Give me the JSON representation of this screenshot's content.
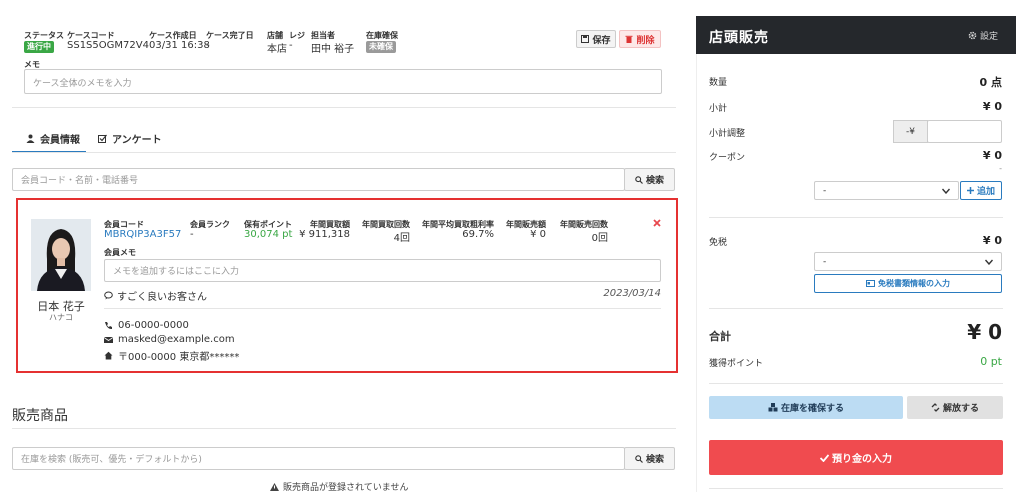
{
  "case": {
    "status_label": "ステータス",
    "status_badge": "進行中",
    "status_color": "#3aa745",
    "code_label": "ケースコード",
    "code_value": "SS1S5OGM72V4",
    "created_label": "ケース作成日",
    "created_value": "03/31 16:38",
    "completed_label": "ケース完了日",
    "completed_value": "-",
    "store_label": "店舗",
    "store_value": "本店",
    "register_label": "レジ",
    "register_value": "-",
    "staff_label": "担当者",
    "staff_value": "田中 裕子",
    "stock_label": "在庫確保",
    "stock_badge": "未確保",
    "save_label": "保存",
    "delete_label": "削除",
    "memo_label": "メモ",
    "memo_placeholder": "ケース全体のメモを入力"
  },
  "tabs": [
    {
      "label": "会員情報",
      "active": true
    },
    {
      "label": "アンケート",
      "active": false
    }
  ],
  "member_search": {
    "placeholder": "会員コード・名前・電話番号",
    "button": "検索"
  },
  "member": {
    "name": "日本 花子",
    "kana": "ハナコ",
    "code_label": "会員コード",
    "code_value": "MBRQIP3A3F57",
    "rank_label": "会員ランク",
    "rank_value": "-",
    "points_label": "保有ポイント",
    "points_value": "30,074 pt",
    "annual_buy_label": "年間買取額",
    "annual_buy_value": "¥ 911,318",
    "annual_buy_count_label": "年間買取回数",
    "annual_buy_count_value": "4回",
    "annual_margin_label": "年間平均買取粗利率",
    "annual_margin_value": "69.7%",
    "annual_sales_label": "年間販売額",
    "annual_sales_value": "¥ 0",
    "annual_sales_count_label": "年間販売回数",
    "annual_sales_count_value": "0回",
    "memo_label": "会員メモ",
    "memo_placeholder": "メモを追加するにはここに入力",
    "comment": "すごく良いお客さん",
    "comment_date": "2023/03/14",
    "phone": "06-0000-0000",
    "email": "masked@example.com",
    "address": "〒000-0000 東京都******"
  },
  "sales": {
    "title": "販売商品",
    "search_placeholder": "在庫を検索 (販売可、優先・デフォルトから)",
    "search_button": "検索",
    "empty_message": "販売商品が登録されていません"
  },
  "panel": {
    "title": "店頭販売",
    "settings_label": "設定",
    "quantity_label": "数量",
    "quantity_value": "0 点",
    "subtotal_label": "小計",
    "subtotal_value": "¥ 0",
    "adjust_label": "小計調整",
    "adjust_prefix": "-¥",
    "coupon_label": "クーポン",
    "coupon_value": "¥ 0",
    "coupon_sub": "-",
    "coupon_select": "-",
    "coupon_add": "追加",
    "taxfree_label": "免税",
    "taxfree_value": "¥ 0",
    "taxfree_select": "-",
    "taxfree_button": "免税書類情報の入力",
    "total_label": "合計",
    "total_value": "¥ 0",
    "earned_label": "獲得ポイント",
    "earned_value": "0 pt",
    "reserve_button": "在庫を確保する",
    "release_button": "解放する",
    "deposit_button": "預り金の入力"
  },
  "colors": {
    "accent_blue": "#2a7bbf",
    "green": "#3aa745",
    "danger": "#e8474d",
    "dark_header": "#25282c",
    "highlight_border": "#e53131"
  }
}
